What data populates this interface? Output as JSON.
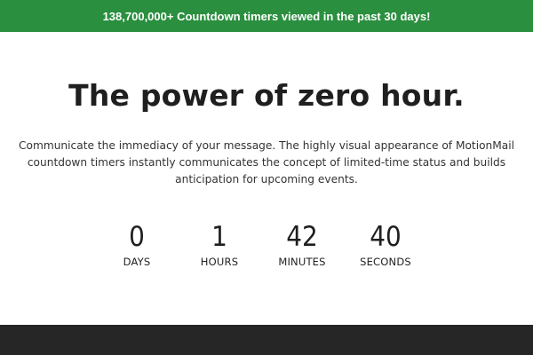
{
  "banner": {
    "text": "138,700,000+ Countdown timers viewed in the past 30 days!",
    "background": "#2a8f3f",
    "text_color": "#ffffff"
  },
  "hero": {
    "headline": "The power of zero hour.",
    "description": "Communicate the immediacy of your message. The highly visual appearance of MotionMail countdown timers instantly communicates the concept of limited-time status and builds anticipation for upcoming events."
  },
  "countdown": {
    "units": [
      {
        "value": "0",
        "label": "DAYS"
      },
      {
        "value": "1",
        "label": "HOURS"
      },
      {
        "value": "42",
        "label": "MINUTES"
      },
      {
        "value": "40",
        "label": "SECONDS"
      }
    ]
  },
  "footer": {
    "background": "#262626"
  }
}
